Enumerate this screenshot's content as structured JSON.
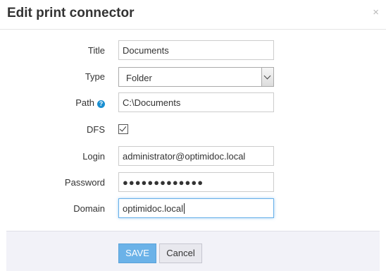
{
  "dialog": {
    "title": "Edit print connector",
    "close_glyph": "×"
  },
  "form": {
    "title": {
      "label": "Title",
      "value": "Documents"
    },
    "type": {
      "label": "Type",
      "value": "Folder"
    },
    "path": {
      "label": "Path",
      "value": "C:\\Documents",
      "help_glyph": "?"
    },
    "dfs": {
      "label": "DFS",
      "checked": true
    },
    "login": {
      "label": "Login",
      "value": "administrator@optimidoc.local"
    },
    "password": {
      "label": "Password",
      "value": "●●●●●●●●●●●●●"
    },
    "domain": {
      "label": "Domain",
      "value": "optimidoc.local"
    }
  },
  "buttons": {
    "save_label": "SAVE",
    "cancel_label": "Cancel"
  },
  "colors": {
    "save_button": "#6bb2e8",
    "help_icon": "#1a8fd1",
    "focus_border": "#66afe9"
  }
}
